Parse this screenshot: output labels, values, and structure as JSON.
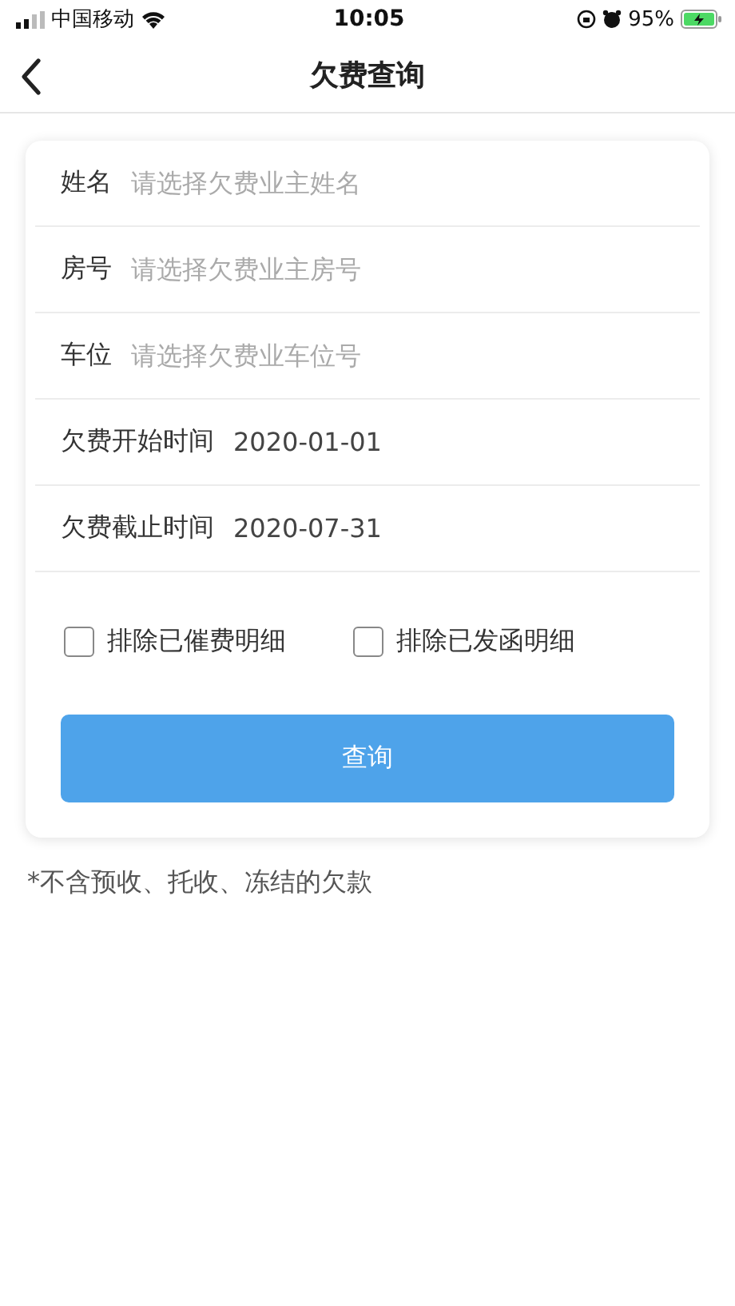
{
  "status_bar": {
    "carrier": "中国移动",
    "time": "10:05",
    "battery": "95%"
  },
  "nav": {
    "title": "欠费查询"
  },
  "form": {
    "fields": [
      {
        "label": "姓名",
        "kind": "select",
        "placeholder": "请选择欠费业主姓名"
      },
      {
        "label": "房号",
        "kind": "select",
        "placeholder": "请选择欠费业主房号"
      },
      {
        "label": "车位",
        "kind": "select",
        "placeholder": "请选择欠费业车位号"
      },
      {
        "label": "欠费开始时间",
        "kind": "value",
        "value": "2020-01-01"
      },
      {
        "label": "欠费截止时间",
        "kind": "value",
        "value": "2020-07-31"
      }
    ],
    "options": [
      {
        "label": "排除已催费明细",
        "checked": false
      },
      {
        "label": "排除已发函明细",
        "checked": false
      }
    ],
    "submit": "查询"
  },
  "note": "*不含预收、托收、冻结的欠款"
}
